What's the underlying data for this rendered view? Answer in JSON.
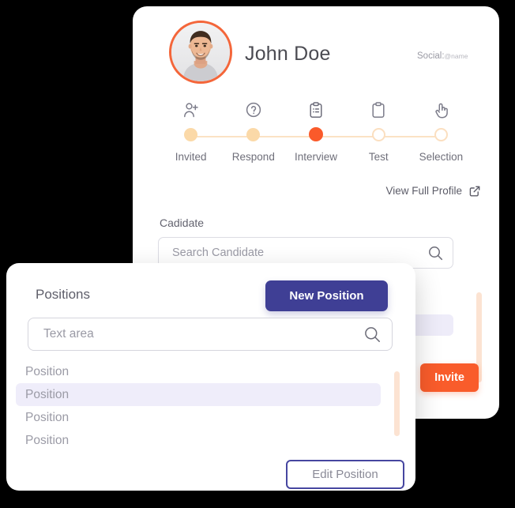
{
  "profile": {
    "name": "John Doe",
    "social_label": "Social:",
    "social_handle": "@name",
    "avatar_icon": "user-photo-avatar",
    "avatar_ring_color": "#f4663a"
  },
  "stepper": {
    "steps": [
      {
        "label": "Invited",
        "icon": "user-plus-icon",
        "state": "done"
      },
      {
        "label": "Respond",
        "icon": "question-circle-icon",
        "state": "done"
      },
      {
        "label": "Interview",
        "icon": "clipboard-list-icon",
        "state": "active"
      },
      {
        "label": "Test",
        "icon": "clipboard-icon",
        "state": "todo"
      },
      {
        "label": "Selection",
        "icon": "pointing-hand-icon",
        "state": "todo"
      }
    ],
    "active_color": "#fa5a2a",
    "done_color": "#fbd9a8",
    "line_color": "#fbe2c4"
  },
  "view_profile": {
    "label": "View Full Profile",
    "icon": "external-link-icon"
  },
  "candidate_field": {
    "label": "Cadidate",
    "placeholder": "Search Candidate",
    "value": "",
    "icon": "search-icon"
  },
  "invite": {
    "label": "Invite",
    "color": "#f95c2b"
  },
  "positions_panel": {
    "title": "Positions",
    "new_position_label": "New Position",
    "new_position_color": "#3f3f95",
    "search": {
      "placeholder": "Text area",
      "value": "",
      "icon": "search-icon"
    },
    "items": [
      {
        "label": "Position",
        "selected": false
      },
      {
        "label": "Position",
        "selected": true
      },
      {
        "label": "Position",
        "selected": false
      },
      {
        "label": "Position",
        "selected": false
      }
    ],
    "selected_row_color": "#efedfa",
    "edit_position_label": "Edit Position",
    "edit_position_border_color": "#4646a0",
    "scrollbar_color": "#fce3d2"
  }
}
